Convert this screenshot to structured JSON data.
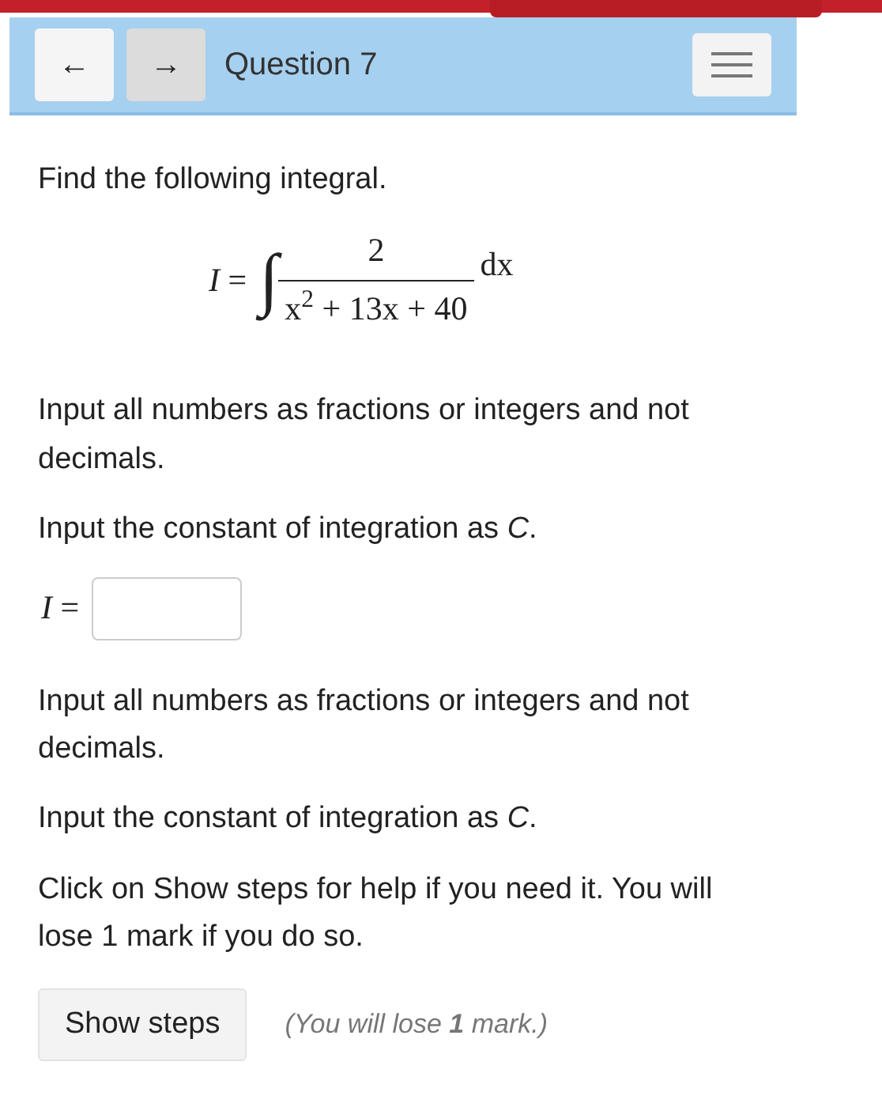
{
  "header": {
    "back_button": "←",
    "forward_button": "→",
    "title": "Question 7"
  },
  "prompt": "Find the following integral.",
  "equation": {
    "lhs": "*I* =",
    "integral": "∫",
    "numerator": "2",
    "denominator": "x$^{2}$ + 13x + 40",
    "differential": "dx"
  },
  "instructions": [
    "Input all numbers as fractions or integers and not decimals.",
    "Input the constant of integration as *C*."
  ],
  "answer": {
    "label": "*I* ="
  },
  "hints": [
    "Input all numbers as fractions or integers and not decimals.",
    "Input the constant of integration as *C*.",
    "Click on Show steps for help if you need it. You will lose 1 mark if you do so."
  ],
  "show_steps": {
    "button": "Show steps",
    "note": "(You will lose **1** mark.)"
  }
}
